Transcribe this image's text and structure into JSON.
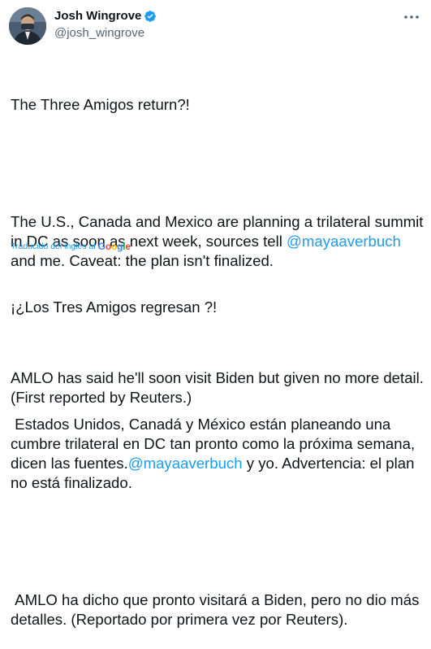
{
  "author": {
    "display_name": "Josh Wingrove",
    "handle": "@josh_wingrove",
    "verified": true
  },
  "icons": [
    "verified-badge-icon",
    "more-options-icon",
    "google-logo-icon"
  ],
  "colors": {
    "link": "#1d9bf0",
    "text": "#0f1419",
    "secondary": "#536471"
  },
  "tweet": {
    "p1": "The Three Amigos return?!",
    "p2_before": "The U.S., Canada and Mexico are planning a trilateral summit in DC as soon as next week, sources tell ",
    "p2_mention": "@mayaaverbuch",
    "p2_after": " and me. Caveat: the plan isn't finalized.",
    "p3": "AMLO has said he'll soon visit Biden but given no more detail. (First reported by Reuters.)"
  },
  "translation": {
    "label": "Traducido del inglés al",
    "provider": "Google",
    "p1": "¡¿Los Tres Amigos regresan ?!",
    "p2_before": " Estados Unidos, Canadá y México están planeando una cumbre trilateral en DC tan pronto como la próxima semana, dicen las fuentes.",
    "p2_mention": "@mayaaverbuch",
    "p2_after": " y yo. Advertencia: el plan no está finalizado.",
    "p3": " AMLO ha dicho que pronto visitará a Biden, pero no dio más detalles. (Reportado por primera vez por Reuters)."
  }
}
